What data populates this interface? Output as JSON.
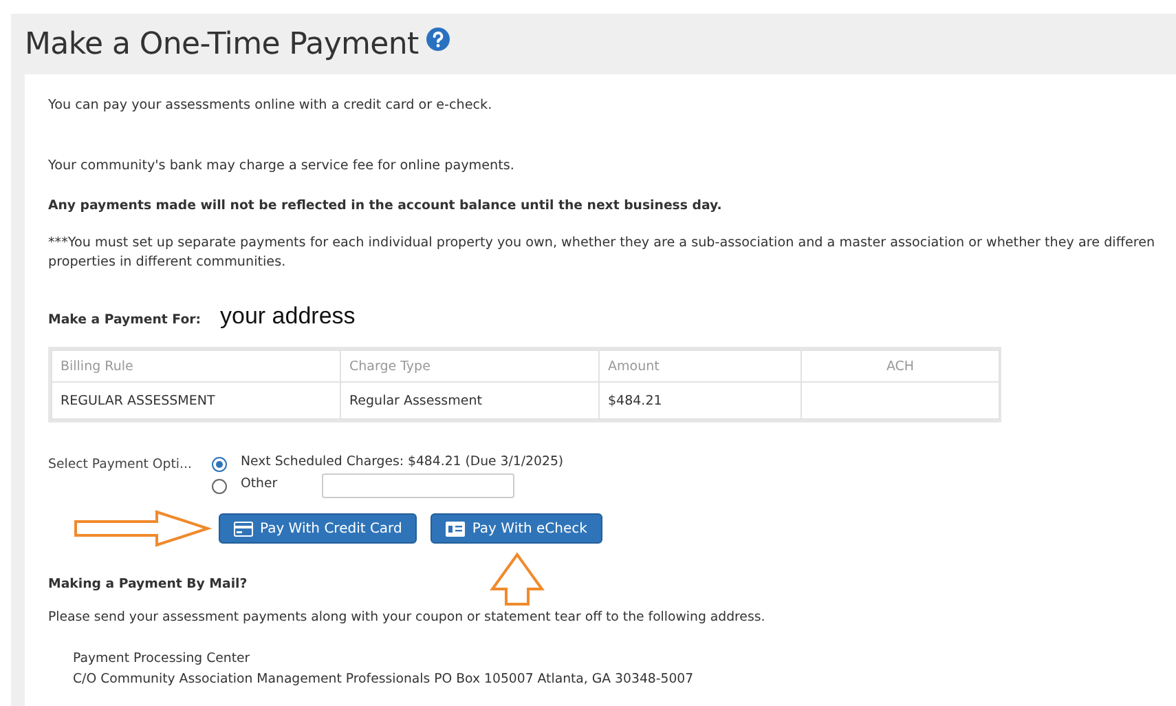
{
  "page": {
    "title": "Make a One-Time Payment"
  },
  "intro": [
    "You can pay your assessments online with a credit card or e-check.",
    "Your community's bank may charge a service fee for online payments."
  ],
  "notice": "Any payments made will not be reflected in the account balance until the next business day.",
  "warning_lines": [
    "***You must set up separate payments for each individual property you own, whether they are a sub-association and a master association or whether they are differen",
    "properties in different communities."
  ],
  "payment_for": {
    "label": "Make a Payment For:",
    "value": "your address"
  },
  "table": {
    "columns": [
      "Billing Rule",
      "Charge Type",
      "Amount",
      "ACH"
    ],
    "rows": [
      [
        "REGULAR ASSESSMENT",
        "Regular Assessment",
        "$484.21",
        ""
      ]
    ]
  },
  "payment_options": {
    "label": "Select Payment Opti...",
    "options": [
      {
        "label": "Next Scheduled Charges: $484.21 (Due 3/1/2025)",
        "selected": true,
        "kind": "plain"
      },
      {
        "label": "Other",
        "selected": false,
        "kind": "amount"
      }
    ]
  },
  "buttons": [
    {
      "label": "Pay With Credit Card",
      "kind": "card"
    },
    {
      "label": "Pay With eCheck",
      "kind": "check"
    }
  ],
  "mail": {
    "heading": "Making a Payment By Mail?",
    "text": "Please send your assessment payments along with your coupon or statement tear off to the following address.",
    "address": [
      "Payment Processing Center",
      "C/O Community Association Management Professionals PO Box 105007 Atlanta, GA 30348-5007"
    ]
  },
  "annotations": [
    {
      "kind": "arrow-right"
    },
    {
      "kind": "arrow-up"
    }
  ]
}
